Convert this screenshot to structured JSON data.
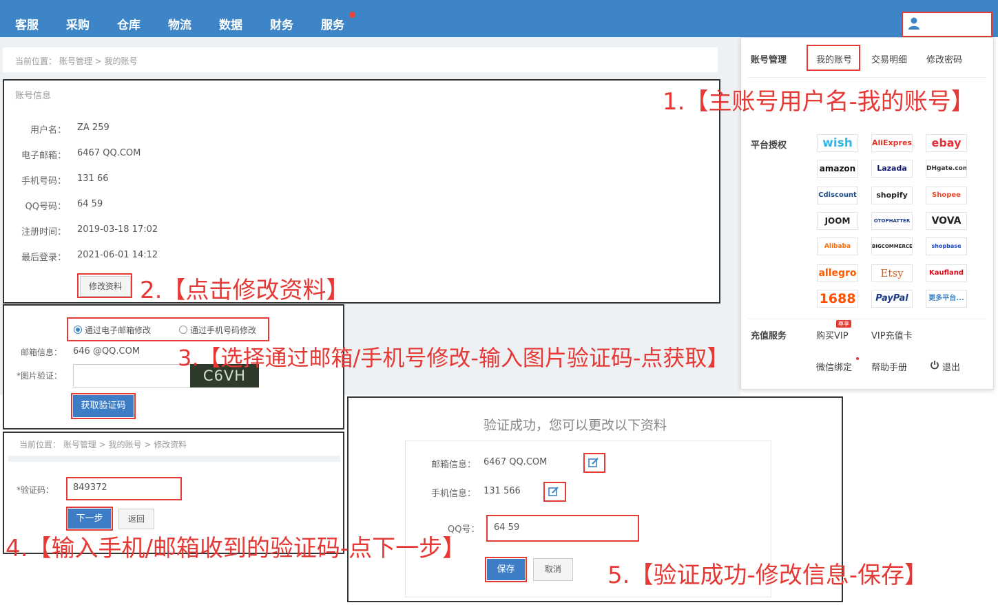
{
  "nav": {
    "items": [
      "客服",
      "采购",
      "仓库",
      "物流",
      "数据",
      "财务",
      "服务"
    ]
  },
  "breadcrumb1": "当前位置： 账号管理 > 我的账号",
  "info": {
    "title": "账号信息",
    "rows": [
      {
        "label": "用户名：",
        "value": "ZA        259"
      },
      {
        "label": "电子邮箱：",
        "value": "6467           QQ.COM"
      },
      {
        "label": "手机号码：",
        "value": "131           66"
      },
      {
        "label": "QQ号码：",
        "value": "64        59"
      },
      {
        "label": "注册时间：",
        "value": "2019-03-18 17:02"
      },
      {
        "label": "最后登录：",
        "value": "2021-06-01 14:12"
      }
    ],
    "edit_button": "修改资料"
  },
  "dropdown": {
    "account_label": "账号管理",
    "tabs": [
      "我的账号",
      "交易明细",
      "修改密码"
    ],
    "platform_label": "平台授权",
    "platforms": [
      "wish",
      "AliExpress",
      "ebay",
      "amazon",
      "Lazada",
      "DHgate.com",
      "Cdiscount",
      "shopify",
      "Shopee",
      "JOOM",
      "OTOPHATTER",
      "VOVA",
      "Alibaba",
      "BIGCOMMERCE",
      "shopbase",
      "allegro",
      "Etsy",
      "Kaufland",
      "1688",
      "PayPal",
      "更多平台..."
    ],
    "recharge_label": "充值服务",
    "buy_vip": "购买VIP",
    "vip_badge": "尊享",
    "vip_card": "VIP充值卡",
    "wechat": "微信绑定",
    "help": "帮助手册",
    "logout": "退出"
  },
  "verify": {
    "radio_email": "通过电子邮箱修改",
    "radio_phone": "通过手机号码修改",
    "email_label": "邮箱信息：",
    "email_value": "646          @QQ.COM",
    "captcha_label": "*图片验证：",
    "captcha_text": "C6VH",
    "get_code_button": "获取验证码"
  },
  "step4": {
    "breadcrumb": "当前位置： 账号管理 > 我的账号 > 修改资料",
    "code_label": "*验证码：",
    "code_value": "849372",
    "next_button": "下一步",
    "back_button": "返回"
  },
  "step5": {
    "title": "验证成功，您可以更改以下资料",
    "email_label": "邮箱信息：",
    "email_value": "6467          QQ.COM",
    "phone_label": "手机信息：",
    "phone_value": "131          566",
    "qq_label": "QQ号：",
    "qq_value": "64       59",
    "save_button": "保存",
    "cancel_button": "取消"
  },
  "annotations": {
    "a1": "1.【主账号用户名-我的账号】",
    "a2": "2.【点击修改资料】",
    "a3": "3.【选择通过邮箱/手机号修改-输入图片验证码-点获取】",
    "a4": "4.【输入手机/邮箱收到的验证码-点下一步】",
    "a5": "5.【验证成功-修改信息-保存】"
  },
  "colors": {
    "primary": "#3d85c6",
    "annotation": "#e53935"
  }
}
